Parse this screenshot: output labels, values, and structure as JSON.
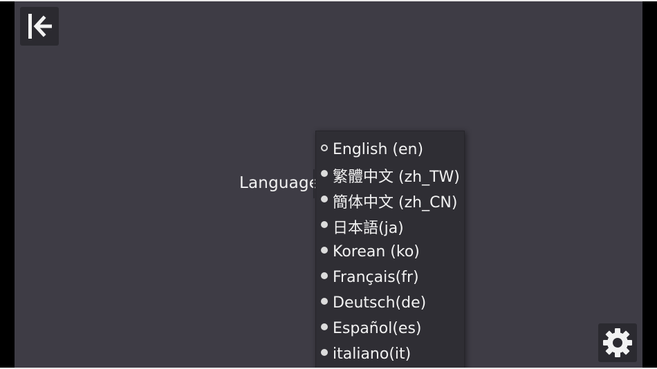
{
  "header": {
    "back_icon": "back-to-start-icon"
  },
  "footer": {
    "settings_icon": "gear-icon"
  },
  "language": {
    "label": "Language",
    "selected_index": 0,
    "options": [
      {
        "label": "English (en)"
      },
      {
        "label": "繁體中文 (zh_TW)"
      },
      {
        "label": "簡体中文 (zh_CN)"
      },
      {
        "label": "日本語(ja)"
      },
      {
        "label": "Korean (ko)"
      },
      {
        "label": "Français(fr)"
      },
      {
        "label": "Deutsch(de)"
      },
      {
        "label": "Español(es)"
      },
      {
        "label": "italiano(it)"
      }
    ]
  },
  "colors": {
    "background": "#3e3c45",
    "panel": "#2f2e34",
    "button": "#2b2a30",
    "text": "#f2f2f2"
  }
}
